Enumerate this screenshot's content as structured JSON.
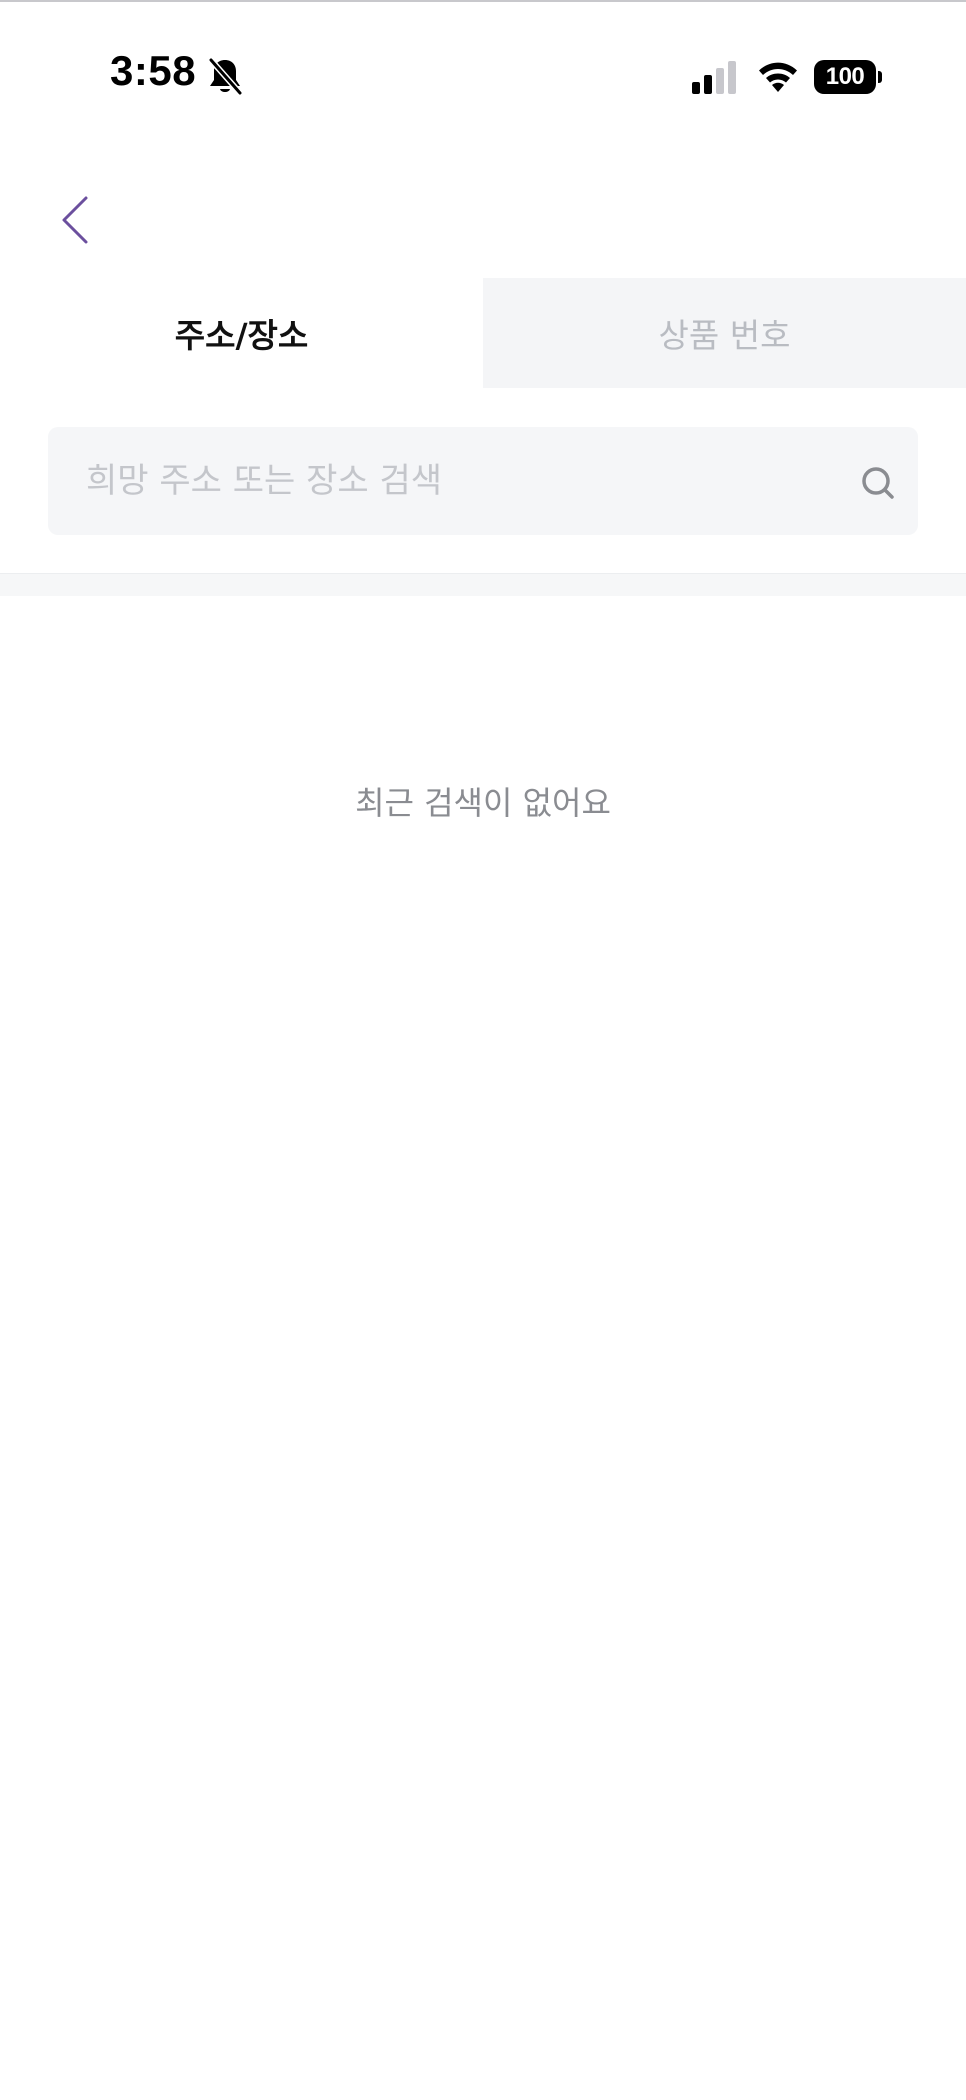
{
  "status_bar": {
    "time": "3:58",
    "battery": "100",
    "icons": [
      "bell-slash-icon",
      "signal-icon",
      "wifi-icon",
      "battery-icon"
    ]
  },
  "header": {
    "back_icon": "chevron-left-icon",
    "back_color": "#6b4f9e"
  },
  "tabs": [
    {
      "label": "주소/장소",
      "active": true
    },
    {
      "label": "상품 번호",
      "active": false
    }
  ],
  "search": {
    "value": "",
    "placeholder": "희망 주소 또는 장소 검색",
    "icon": "search-icon"
  },
  "recent": {
    "empty_message": "최근 검색이 없어요"
  },
  "colors": {
    "accent": "#6b4f9e",
    "inactive_tab_bg": "#f4f5f7",
    "inactive_tab_text": "#b9bcc2",
    "search_bg": "#f5f6f8",
    "muted_text": "#8a8c91"
  }
}
